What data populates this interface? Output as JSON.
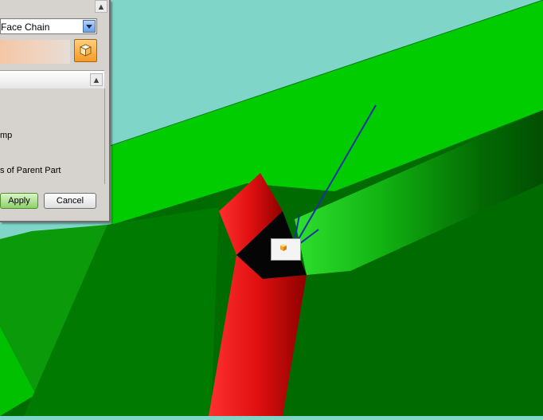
{
  "dialog": {
    "selection_type_value": "Face Chain",
    "option_lines": [
      "mp",
      "s of Parent Part"
    ],
    "apply_label": "Apply",
    "cancel_label": "Cancel",
    "expand_icon": "chevron-up-icon",
    "dropdown_icon": "chevron-down-icon",
    "cube_icon": "cube-icon"
  },
  "viewport": {
    "colors": {
      "background": "#7fd6c8",
      "bright_green": "#00cc00",
      "dark_green": "#006b00",
      "red": "#e01010",
      "black": "#050505",
      "arrow": "#1f2fa8"
    },
    "selection_marker_icon": "cube-icon"
  }
}
